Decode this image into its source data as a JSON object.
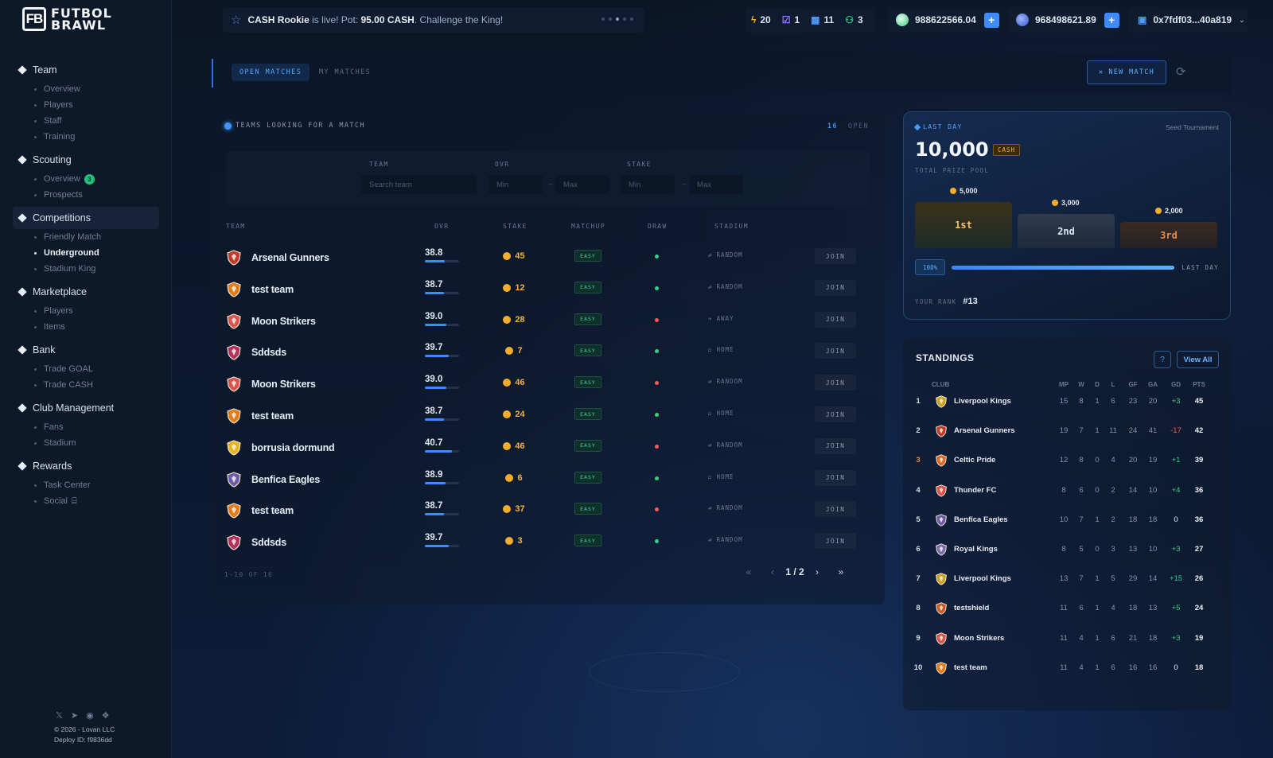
{
  "brand": {
    "logo_mark": "FB",
    "logo_line1": "FUTBOL",
    "logo_line2": "BRAWL"
  },
  "sidebar": {
    "sections": [
      {
        "label": "Team",
        "items": [
          "Overview",
          "Players",
          "Staff",
          "Training"
        ]
      },
      {
        "label": "Scouting",
        "items": [
          "Overview",
          "Prospects"
        ],
        "overview_badge": "3"
      },
      {
        "label": "Competitions",
        "items": [
          "Friendly Match",
          "Underground",
          "Stadium King"
        ],
        "active": true,
        "active_item": "Underground"
      },
      {
        "label": "Marketplace",
        "items": [
          "Players",
          "Items"
        ]
      },
      {
        "label": "Bank",
        "items": [
          "Trade GOAL",
          "Trade CASH"
        ]
      },
      {
        "label": "Club Management",
        "items": [
          "Fans",
          "Stadium"
        ]
      },
      {
        "label": "Rewards",
        "items": [
          "Task Center",
          "Social"
        ]
      }
    ],
    "social_icons": [
      "x-icon",
      "telegram-icon",
      "discord-icon",
      "gitbook-icon"
    ],
    "copyright": "© 2026 - Lovan LLC",
    "deploy": "Deploy ID: f9836dd"
  },
  "topbar": {
    "ticker_bold1": "CASH Rookie",
    "ticker_mid": " is live! Pot: ",
    "ticker_bold2": "95.00 CASH",
    "ticker_end": ". Challenge the King!",
    "energy": "20",
    "tasks": "1",
    "gifts": "11",
    "friends": "3",
    "goal_balance": "988622566.04",
    "cash_balance": "968498621.89",
    "wallet": "0x7fdf03...40a819"
  },
  "tabs": {
    "open": "OPEN MATCHES",
    "my": "MY MATCHES",
    "new_match": "NEW MATCH"
  },
  "teams_panel": {
    "title": "TEAMS LOOKING FOR A MATCH",
    "open_count": "16",
    "open_label": "OPEN",
    "filter_team": "TEAM",
    "filter_ovr": "OVR",
    "filter_stake": "STAKE",
    "search_placeholder": "Search team",
    "min_placeholder": "Min",
    "max_placeholder": "Max",
    "columns": [
      "TEAM",
      "OVR",
      "STAKE",
      "MATCHUP",
      "DRAW",
      "STADIUM"
    ],
    "rows": [
      {
        "team": "Arsenal Gunners",
        "ovr": "38.8",
        "ovr_fill": 0.58,
        "stake": "45",
        "matchup": "EASY",
        "draw": "green",
        "stadium": "RANDOM",
        "crest": "#c0392b"
      },
      {
        "team": "test team",
        "ovr": "38.7",
        "ovr_fill": 0.56,
        "stake": "12",
        "matchup": "EASY",
        "draw": "green",
        "stadium": "RANDOM",
        "crest": "#e07b1f"
      },
      {
        "team": "Moon Strikers",
        "ovr": "39.0",
        "ovr_fill": 0.62,
        "stake": "28",
        "matchup": "EASY",
        "draw": "red",
        "stadium": "AWAY",
        "crest": "#d9534f"
      },
      {
        "team": "Sddsds",
        "ovr": "39.7",
        "ovr_fill": 0.7,
        "stake": "7",
        "matchup": "EASY",
        "draw": "green",
        "stadium": "HOME",
        "crest": "#b03060"
      },
      {
        "team": "Moon Strikers",
        "ovr": "39.0",
        "ovr_fill": 0.62,
        "stake": "46",
        "matchup": "EASY",
        "draw": "red",
        "stadium": "RANDOM",
        "crest": "#d9534f"
      },
      {
        "team": "test team",
        "ovr": "38.7",
        "ovr_fill": 0.56,
        "stake": "24",
        "matchup": "EASY",
        "draw": "green",
        "stadium": "HOME",
        "crest": "#e07b1f"
      },
      {
        "team": "borrusia dormund",
        "ovr": "40.7",
        "ovr_fill": 0.8,
        "stake": "46",
        "matchup": "EASY",
        "draw": "red",
        "stadium": "RANDOM",
        "crest": "#e6b422"
      },
      {
        "team": "Benfica Eagles",
        "ovr": "38.9",
        "ovr_fill": 0.6,
        "stake": "6",
        "matchup": "EASY",
        "draw": "green",
        "stadium": "HOME",
        "crest": "#6b5ba8"
      },
      {
        "team": "test team",
        "ovr": "38.7",
        "ovr_fill": 0.56,
        "stake": "37",
        "matchup": "EASY",
        "draw": "red",
        "stadium": "RANDOM",
        "crest": "#e07b1f"
      },
      {
        "team": "Sddsds",
        "ovr": "39.7",
        "ovr_fill": 0.7,
        "stake": "3",
        "matchup": "EASY",
        "draw": "green",
        "stadium": "RANDOM",
        "crest": "#b03060"
      }
    ],
    "join_label": "JOIN",
    "range": "1-10 OF 16",
    "page": "1 / 2"
  },
  "prize": {
    "tag": "LAST DAY",
    "subtitle": "Seed Tournament",
    "amount": "10,000",
    "currency": "CASH",
    "amount_label": "TOTAL PRIZE POOL",
    "first": "1st",
    "first_prize": "5,000",
    "second": "2nd",
    "second_prize": "3,000",
    "third": "3rd",
    "third_prize": "2,000",
    "progress": "100%",
    "progress_fill": 1.0,
    "progress_label": "LAST DAY",
    "rank_label": "YOUR RANK",
    "rank": "#13"
  },
  "standings": {
    "title": "STANDINGS",
    "view_all": "View All",
    "help": "?",
    "headers": [
      "CLUB",
      "MP",
      "W",
      "D",
      "L",
      "GF",
      "GA",
      "GD",
      "PTS"
    ],
    "rows": [
      {
        "pos": "1",
        "club": "Liverpool Kings",
        "mp": "15",
        "w": "8",
        "d": "1",
        "l": "6",
        "gf": "23",
        "ga": "20",
        "gd": "+3",
        "pts": "45",
        "crest": "#c9a227"
      },
      {
        "pos": "2",
        "club": "Arsenal Gunners",
        "mp": "19",
        "w": "7",
        "d": "1",
        "l": "11",
        "gf": "24",
        "ga": "41",
        "gd": "-17",
        "pts": "42",
        "crest": "#c0392b"
      },
      {
        "pos": "3",
        "club": "Celtic Pride",
        "mp": "12",
        "w": "8",
        "d": "0",
        "l": "4",
        "gf": "20",
        "ga": "19",
        "gd": "+1",
        "pts": "39",
        "crest": "#e0672a"
      },
      {
        "pos": "4",
        "club": "Thunder FC",
        "mp": "8",
        "w": "6",
        "d": "0",
        "l": "2",
        "gf": "14",
        "ga": "10",
        "gd": "+4",
        "pts": "36",
        "crest": "#d9534f"
      },
      {
        "pos": "5",
        "club": "Benfica Eagles",
        "mp": "10",
        "w": "7",
        "d": "1",
        "l": "2",
        "gf": "18",
        "ga": "18",
        "gd": "0",
        "pts": "36",
        "crest": "#6b5ba8"
      },
      {
        "pos": "6",
        "club": "Royal Kings",
        "mp": "8",
        "w": "5",
        "d": "0",
        "l": "3",
        "gf": "13",
        "ga": "10",
        "gd": "+3",
        "pts": "27",
        "crest": "#7a6bb8"
      },
      {
        "pos": "7",
        "club": "Liverpool Kings",
        "mp": "13",
        "w": "7",
        "d": "1",
        "l": "5",
        "gf": "29",
        "ga": "14",
        "gd": "+15",
        "pts": "26",
        "crest": "#c9a227"
      },
      {
        "pos": "8",
        "club": "testshield",
        "mp": "11",
        "w": "6",
        "d": "1",
        "l": "4",
        "gf": "18",
        "ga": "13",
        "gd": "+5",
        "pts": "24",
        "crest": "#c85a2a"
      },
      {
        "pos": "9",
        "club": "Moon Strikers",
        "mp": "11",
        "w": "4",
        "d": "1",
        "l": "6",
        "gf": "21",
        "ga": "18",
        "gd": "+3",
        "pts": "19",
        "crest": "#d9534f"
      },
      {
        "pos": "10",
        "club": "test team",
        "mp": "11",
        "w": "4",
        "d": "1",
        "l": "6",
        "gf": "16",
        "ga": "16",
        "gd": "0",
        "pts": "18",
        "crest": "#e07b1f"
      }
    ]
  },
  "colors": {
    "accent": "#3d8cff",
    "gold": "#f1ad2b",
    "green": "#33d18a",
    "red": "#ff5a5a",
    "bronze": "#ee8a3a"
  }
}
